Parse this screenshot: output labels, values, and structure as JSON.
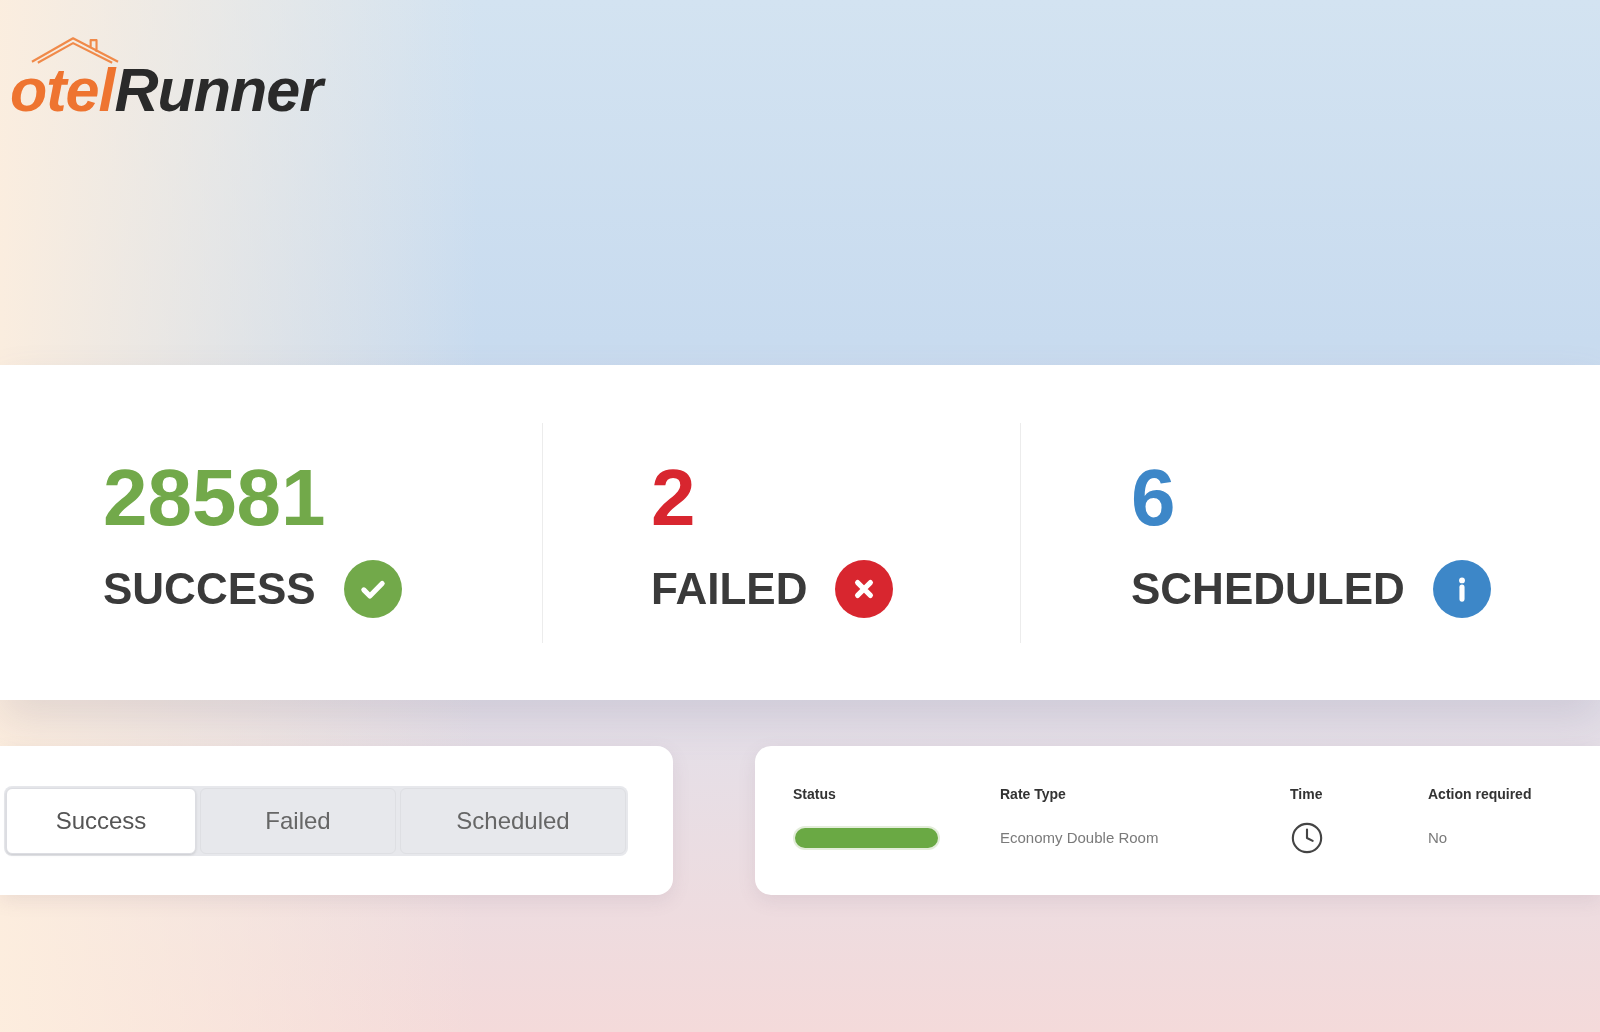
{
  "logo": {
    "text_accent": "otel",
    "text": "Runner"
  },
  "stats": [
    {
      "kind": "success",
      "value": "28581",
      "label": "SUCCESS",
      "color": "#72a94a"
    },
    {
      "kind": "failed",
      "value": "2",
      "label": "FAILED",
      "color": "#d8262f"
    },
    {
      "kind": "scheduled",
      "value": "6",
      "label": "SCHEDULED",
      "color": "#3d87c8"
    }
  ],
  "tabs": [
    {
      "label": "Success",
      "selected": true
    },
    {
      "label": "Failed",
      "selected": false
    },
    {
      "label": "Scheduled",
      "selected": false
    }
  ],
  "table": {
    "columns": [
      "Status",
      "Rate Type",
      "Time",
      "Action required"
    ],
    "rows": [
      {
        "status": {
          "level": 1
        },
        "rate_type": "Economy Double Room",
        "action_required": "No"
      }
    ]
  }
}
